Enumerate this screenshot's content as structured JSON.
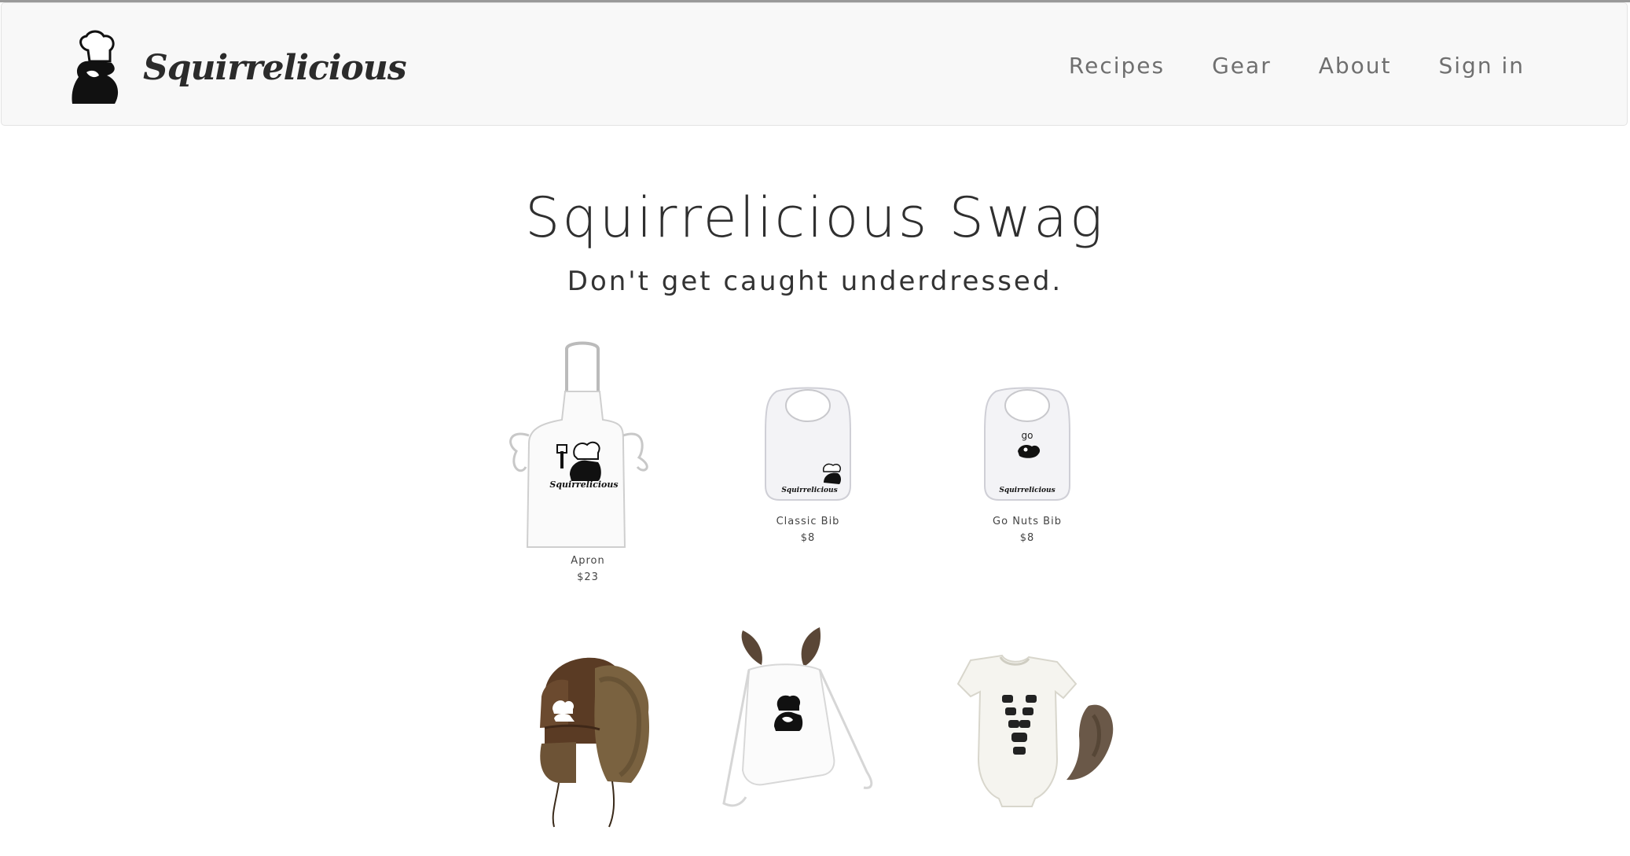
{
  "brand": {
    "name": "Squirrelicious",
    "logo_icon": "chef-squirrel-logo-icon"
  },
  "nav": [
    {
      "label": "Recipes"
    },
    {
      "label": "Gear"
    },
    {
      "label": "About"
    },
    {
      "label": "Sign in"
    }
  ],
  "hero": {
    "title": "Squirrelicious Swag",
    "subtitle": "Don't get caught underdressed."
  },
  "products": [
    {
      "name": "Apron",
      "price": "$23",
      "image_icon": "apron-image",
      "print_text": "Squirrelicious"
    },
    {
      "name": "Classic Bib",
      "price": "$8",
      "image_icon": "bib-image",
      "print_text": "Squirrelicious"
    },
    {
      "name": "Go Nuts Bib",
      "price": "$8",
      "image_icon": "bib-go-nuts-image",
      "print_text": "Squirrelicious",
      "print_top_text": "go"
    },
    {
      "image_icon": "fur-trapper-hat-image"
    },
    {
      "image_icon": "drawstring-backpack-with-ears-image"
    },
    {
      "image_icon": "onesie-with-tail-image"
    }
  ]
}
